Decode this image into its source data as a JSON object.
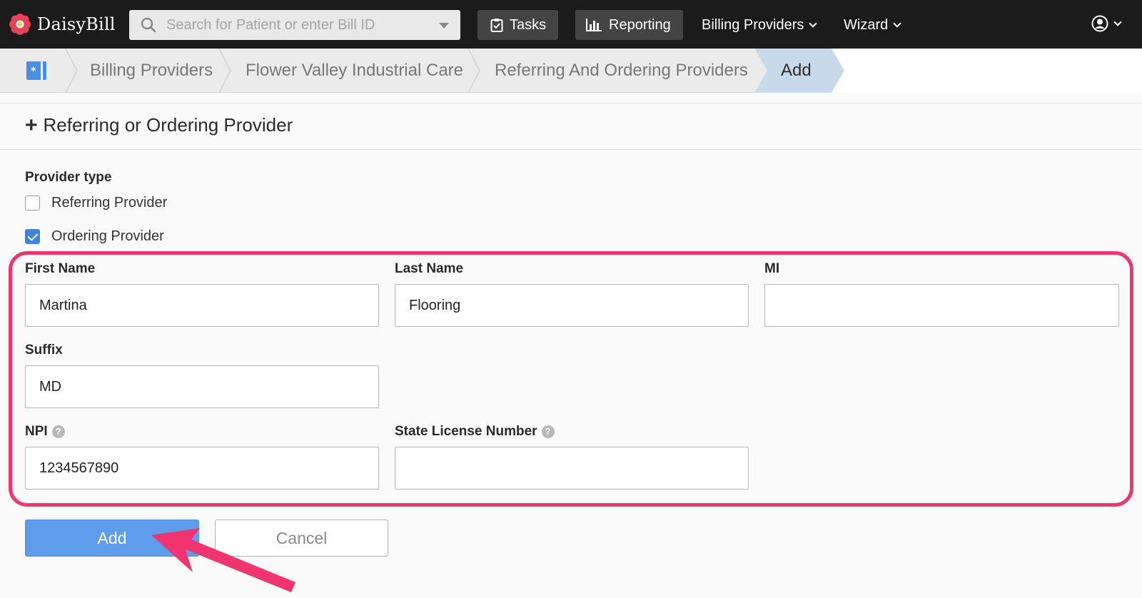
{
  "topnav": {
    "brand": "DaisyBill",
    "search_placeholder": "Search for Patient or enter Bill ID",
    "tasks_label": "Tasks",
    "reporting_label": "Reporting",
    "billing_providers_label": "Billing Providers",
    "wizard_label": "Wizard"
  },
  "breadcrumb": {
    "items": [
      "Billing Providers",
      "Flower Valley Industrial Care",
      "Referring And Ordering Providers"
    ],
    "current": "Add"
  },
  "form": {
    "title": "Referring or Ordering Provider",
    "provider_type_label": "Provider type",
    "options": [
      {
        "label": "Referring Provider",
        "checked": false
      },
      {
        "label": "Ordering Provider",
        "checked": true
      }
    ],
    "first_name_label": "First Name",
    "first_name_value": "Martina",
    "last_name_label": "Last Name",
    "last_name_value": "Flooring",
    "mi_label": "MI",
    "mi_value": "",
    "suffix_label": "Suffix",
    "suffix_value": "MD",
    "npi_label": "NPI",
    "npi_value": "1234567890",
    "license_label": "State License Number",
    "license_value": "",
    "add_button": "Add",
    "cancel_button": "Cancel"
  },
  "colors": {
    "nav_bg": "#1b1b1b",
    "highlight": "#f0346f",
    "primary": "#5e9cec",
    "checkbox": "#3d86dd"
  }
}
